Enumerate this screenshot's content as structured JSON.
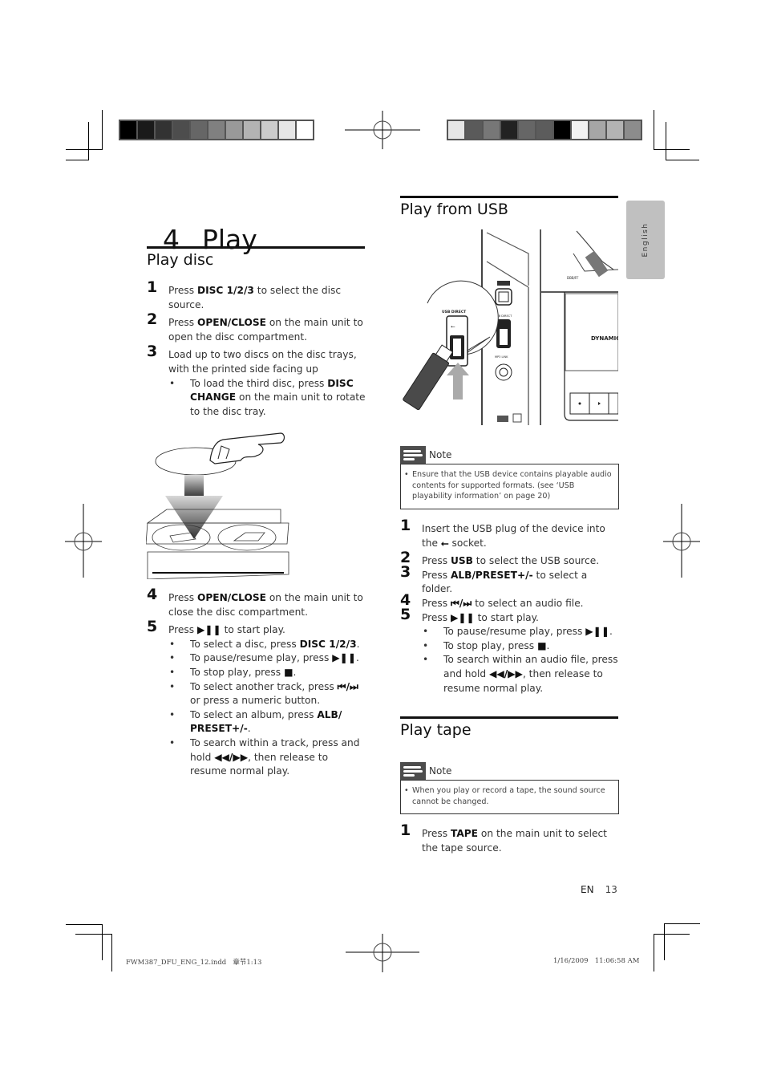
{
  "colors": {
    "left_bar": [
      "#000000",
      "#1a1a1a",
      "#333333",
      "#4d4d4d",
      "#666666",
      "#808080",
      "#999999",
      "#b3b3b3",
      "#cccccc",
      "#e6e6e6",
      "#ffffff"
    ],
    "right_bar": [
      "#e6e6e6",
      "#5a5a5a",
      "#777777",
      "#222222",
      "#666666",
      "#5c5c5c",
      "#000000",
      "#f2f2f2",
      "#a6a6a6",
      "#b3b3b3",
      "#8c8c8c"
    ],
    "language_tab": "#c0c0c0",
    "note_icon": "#4d4d4d"
  },
  "chapter": {
    "number": "4",
    "title": "Play"
  },
  "language_tab": "English",
  "play_disc": {
    "heading": "Play disc",
    "steps": [
      {
        "num": "1",
        "parts": [
          "Press ",
          "DISC 1/2/3",
          " to select the disc source."
        ]
      },
      {
        "num": "2",
        "parts": [
          "Press ",
          "OPEN/CLOSE",
          " on the main unit to open the disc compartment."
        ]
      },
      {
        "num": "3",
        "text": "Load up to two discs on the disc trays, with the printed side facing up",
        "bullets": [
          {
            "parts": [
              "To load the third disc, press ",
              "DISC CHANGE",
              " on the main unit to rotate to the disc tray."
            ]
          }
        ]
      },
      {
        "num": "4",
        "parts": [
          "Press ",
          "OPEN/CLOSE",
          " on the main unit to close the disc compartment."
        ]
      },
      {
        "num": "5",
        "parts": [
          "Press ",
          "▶❚❚",
          " to start play."
        ],
        "bullets": [
          {
            "parts": [
              "To select a disc, press ",
              "DISC 1/2/3",
              "."
            ]
          },
          {
            "parts": [
              "To pause/resume play, press ",
              "▶❚❚",
              "."
            ]
          },
          {
            "parts": [
              "To stop play, press ",
              "■",
              "."
            ]
          },
          {
            "parts": [
              "To select another track, press ",
              "⏮/⏭",
              " or press a numeric button."
            ]
          },
          {
            "parts": [
              "To select an album, press ",
              "ALB/ PRESET+/-",
              "."
            ]
          },
          {
            "parts": [
              "To search within a track, press and hold ",
              "◀◀/▶▶",
              ", then release to resume normal play."
            ]
          }
        ]
      }
    ],
    "illustration": "disc-loading-illustration"
  },
  "play_usb": {
    "heading": "Play from USB",
    "illustration": {
      "name": "usb-direct-illustration",
      "labels": [
        "USB DIRECT",
        "USB DIRECT",
        "MP3 LINK",
        "DYNAMIC"
      ]
    },
    "note": {
      "label": "Note",
      "text": "Ensure that the USB device contains playable audio contents for supported formats. (see ‘USB playability information’ on page 20)"
    },
    "steps": [
      {
        "num": "1",
        "parts": [
          "Insert the USB plug of the device into the ",
          "⭠",
          " socket."
        ]
      },
      {
        "num": "2",
        "parts": [
          "Press ",
          "USB",
          " to select the USB source."
        ]
      },
      {
        "num": "3",
        "parts": [
          "Press ",
          "ALB/PRESET+/-",
          " to select a folder."
        ]
      },
      {
        "num": "4",
        "parts": [
          "Press ",
          "⏮/⏭",
          " to select an audio file."
        ]
      },
      {
        "num": "5",
        "parts": [
          "Press ",
          "▶❚❚",
          " to start play."
        ],
        "bullets": [
          {
            "parts": [
              "To pause/resume play, press ",
              "▶❚❚",
              "."
            ]
          },
          {
            "parts": [
              "To stop play, press ",
              "■",
              "."
            ]
          },
          {
            "parts": [
              "To search within an audio file, press and hold ",
              "◀◀/▶▶",
              ", then release to resume normal play."
            ]
          }
        ]
      }
    ]
  },
  "play_tape": {
    "heading": "Play tape",
    "note": {
      "label": "Note",
      "text": "When you play or record a tape, the sound source cannot be changed."
    },
    "steps": [
      {
        "num": "1",
        "parts": [
          "Press ",
          "TAPE",
          " on the main unit to select the tape source."
        ]
      }
    ]
  },
  "footer": {
    "lang": "EN",
    "page": "13",
    "slug_left": "FWM387_DFU_ENG_12.indd   章节1:13",
    "slug_right": "1/16/2009   11:06:58 AM"
  }
}
